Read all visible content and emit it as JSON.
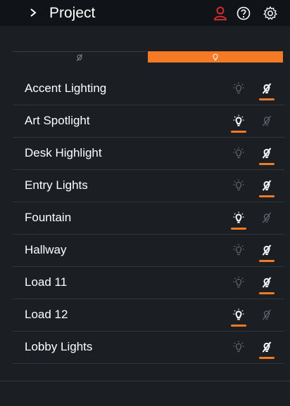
{
  "header": {
    "title": "Project"
  },
  "colors": {
    "accent": "#f47a26",
    "alert": "#e0302a",
    "bg": "#1b1f24",
    "topbar": "#101317"
  },
  "icons": {
    "back": "chevron-right-icon",
    "user": "user-icon",
    "help": "help-icon",
    "settings": "gear-icon",
    "tabs": [
      "panel-icon",
      "lightbulb-icon",
      "house-icon",
      "sliders-icon"
    ]
  },
  "loads": [
    {
      "label": "Accent Lighting",
      "state": "off"
    },
    {
      "label": "Art Spotlight",
      "state": "on"
    },
    {
      "label": "Desk Highlight",
      "state": "off"
    },
    {
      "label": "Entry Lights",
      "state": "off"
    },
    {
      "label": "Fountain",
      "state": "on"
    },
    {
      "label": "Hallway",
      "state": "off"
    },
    {
      "label": "Load 11",
      "state": "off"
    },
    {
      "label": "Load 12",
      "state": "on"
    },
    {
      "label": "Lobby Lights",
      "state": "off"
    }
  ]
}
